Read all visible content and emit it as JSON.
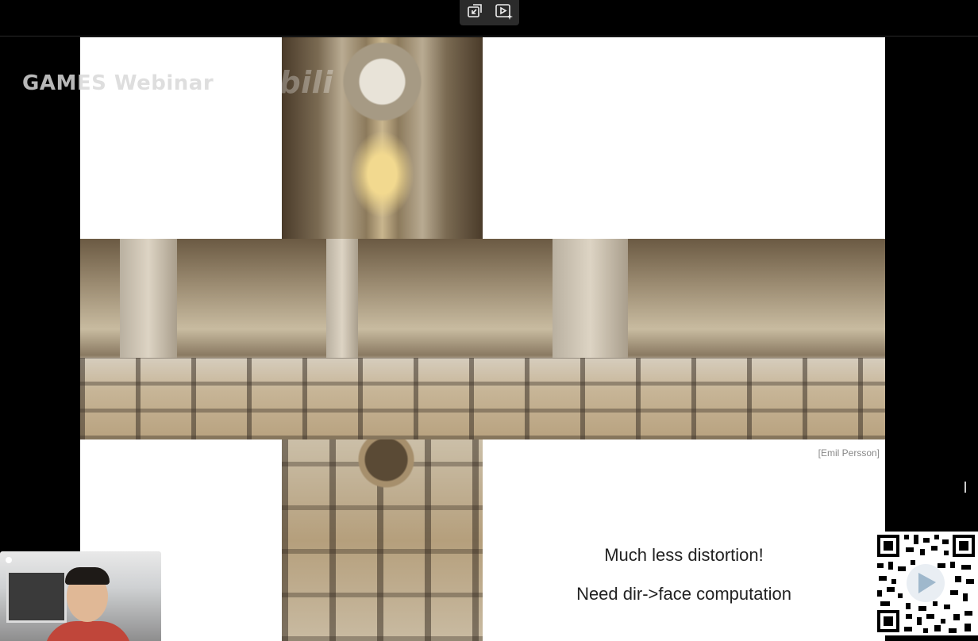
{
  "toolbar": {
    "exit_fullscreen_icon": "exit-fullscreen-icon",
    "ai_video_icon": "ai-video-icon"
  },
  "watermark": {
    "text": "GAMES Webinar",
    "logo_text": "bilibili"
  },
  "slide": {
    "credit": "[Emil Persson]",
    "caption_1": "Much less distortion!",
    "caption_2": "Need dir->face computation"
  },
  "colors": {
    "background": "#000000",
    "slide": "#ffffff",
    "text": "#222222"
  }
}
